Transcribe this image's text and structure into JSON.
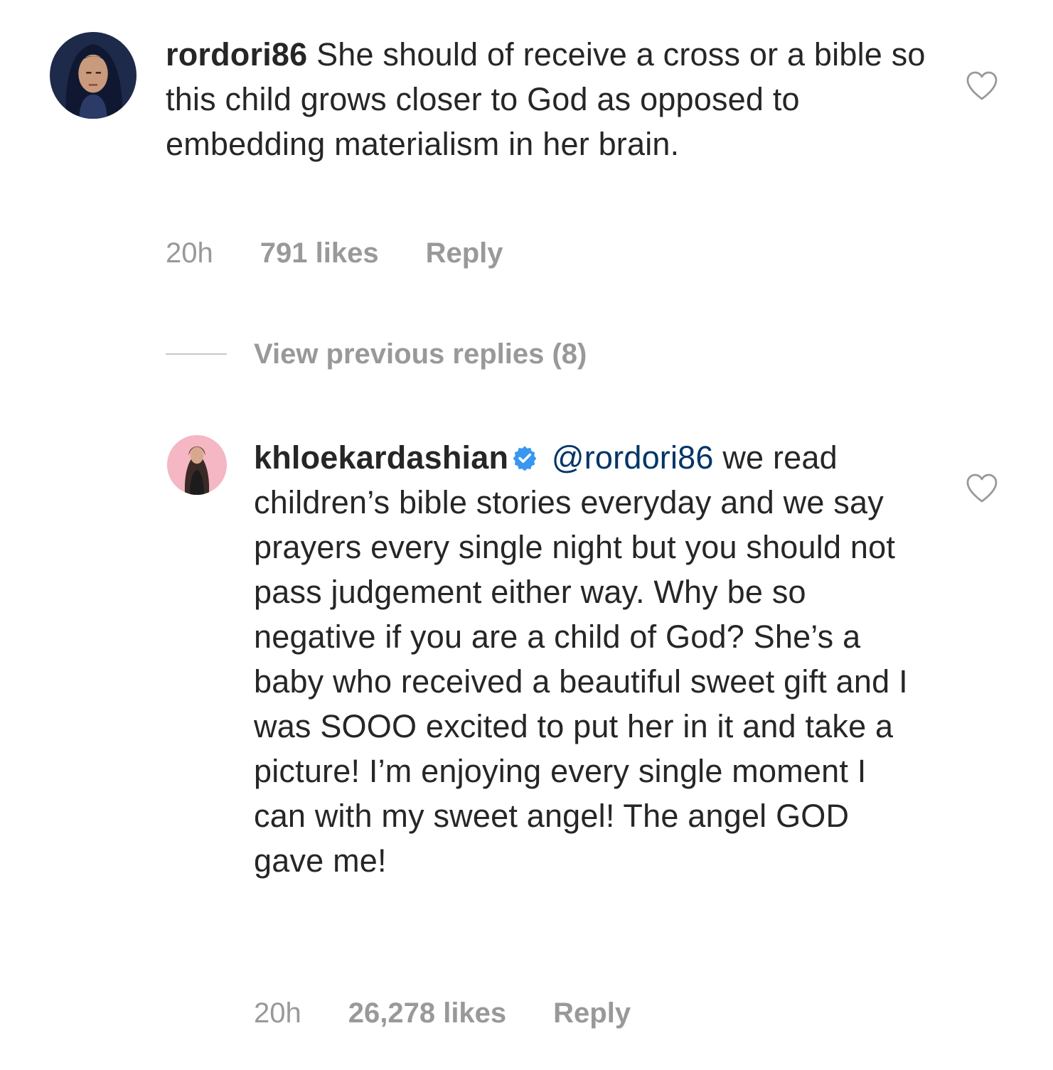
{
  "comments": [
    {
      "username": "rordori86",
      "verified": false,
      "text": "She should of receive a cross or a bible so this child grows closer to God as opposed to embedding materialism in her brain.",
      "time": "20h",
      "likes": "791 likes",
      "reply_label": "Reply",
      "avatar_icon": "profile-photo-dark-hair"
    },
    {
      "username": "khloekardashian",
      "verified": true,
      "mention": "@rordori86",
      "text": "we read children’s bible stories everyday and we say prayers every single night but you should not pass judgement either way. Why be so negative if you are a child of God? She’s a baby who received a beautiful sweet gift and I was SOOO excited to put her in it and take a picture! I’m enjoying every single moment I can with my sweet angel! The angel GOD gave me!",
      "time": "20h",
      "likes": "26,278 likes",
      "reply_label": "Reply",
      "avatar_icon": "profile-photo-pink-background"
    }
  ],
  "view_previous_replies": "View previous replies (8)",
  "icons": {
    "like": "heart-outline-icon",
    "verified": "verified-badge-icon"
  },
  "colors": {
    "text": "#262626",
    "muted": "#999999",
    "mention": "#003569",
    "verified": "#3897f0"
  }
}
